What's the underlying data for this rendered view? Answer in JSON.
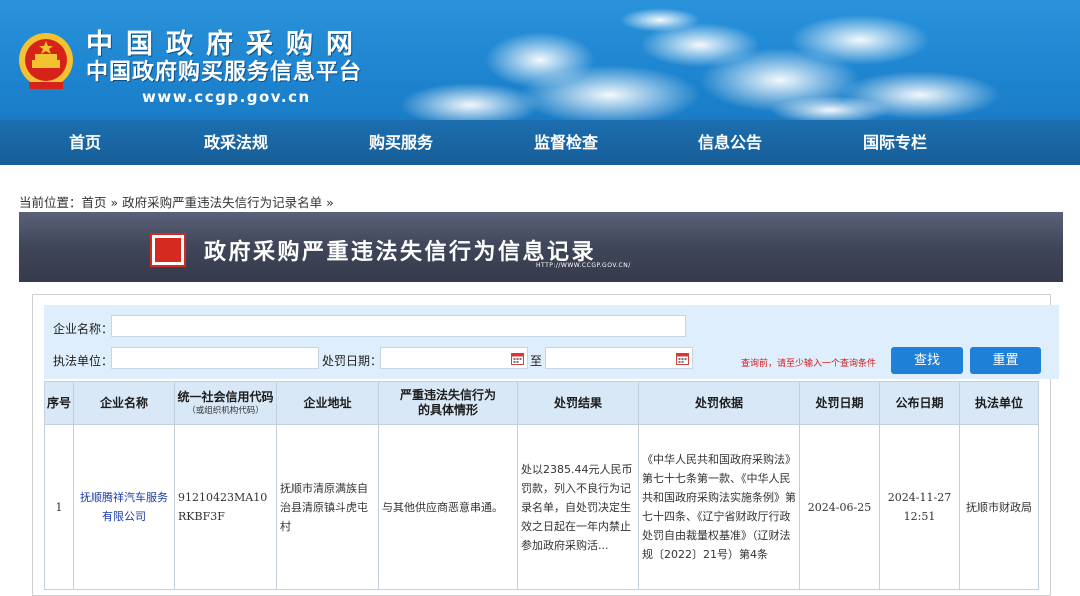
{
  "header": {
    "site_name": "中国政府采购网",
    "site_subtitle": "中国政府购买服务信息平台",
    "site_url": "www.ccgp.gov.cn"
  },
  "nav": {
    "items": [
      {
        "label": "首页"
      },
      {
        "label": "政采法规"
      },
      {
        "label": "购买服务"
      },
      {
        "label": "监督检查"
      },
      {
        "label": "信息公告"
      },
      {
        "label": "国际专栏"
      }
    ]
  },
  "breadcrumb": {
    "prefix": "当前位置：",
    "home": "首页",
    "sep": " » ",
    "current": "政府采购严重违法失信行为记录名单",
    "tail": " »"
  },
  "banner": {
    "title": "政府采购严重违法失信行为信息记录",
    "url": "HTTP://WWW.CCGP.GOV.CN/"
  },
  "search": {
    "company_label": "企业名称：",
    "company_value": "",
    "agency_label": "执法单位：",
    "agency_value": "",
    "date_label": "处罚日期：",
    "date_to": "至",
    "hint": "查询前，请至少输入一个查询条件",
    "search_button": "查找",
    "reset_button": "重置"
  },
  "table": {
    "headers": [
      {
        "label": "序号"
      },
      {
        "label": "企业名称"
      },
      {
        "label": "统一社会信用代码",
        "sub": "（或组织机构代码）"
      },
      {
        "label": "企业地址"
      },
      {
        "label": "严重违法失信行为",
        "label2": "的具体情形"
      },
      {
        "label": "处罚结果"
      },
      {
        "label": "处罚依据"
      },
      {
        "label": "处罚日期"
      },
      {
        "label": "公布日期"
      },
      {
        "label": "执法单位"
      }
    ],
    "rows": [
      {
        "index": "1",
        "company": "抚顺腾祥汽车服务有限公司",
        "credit_code": "91210423MA10RKBF3F",
        "address": "抚顺市清原满族自治县清原镇斗虎屯村",
        "situation": "与其他供应商恶意串通。",
        "result": "处以2385.44元人民币罚款，列入不良行为记录名单，自处罚决定生效之日起在一年内禁止参加政府采购活...",
        "basis": "《中华人民共和国政府采购法》第七十七条第一款、《中华人民共和国政府采购法实施条例》第七十四条、《辽宁省财政厅行政处罚自由裁量权基准》（辽财法规〔2022〕21号）第4条",
        "penalty_date": "2024-06-25",
        "publish_date": "2024-11-27",
        "publish_time": "12:51",
        "agency": "抚顺市财政局"
      }
    ]
  },
  "colors": {
    "header_blue": "#2a93da",
    "nav_blue": "#1c6eaf",
    "banner_gray": "#404659",
    "search_bg": "#dfeefc",
    "table_head": "#d9e8f6",
    "button_blue": "#1f80d8",
    "hint_red": "#d71a1a"
  }
}
